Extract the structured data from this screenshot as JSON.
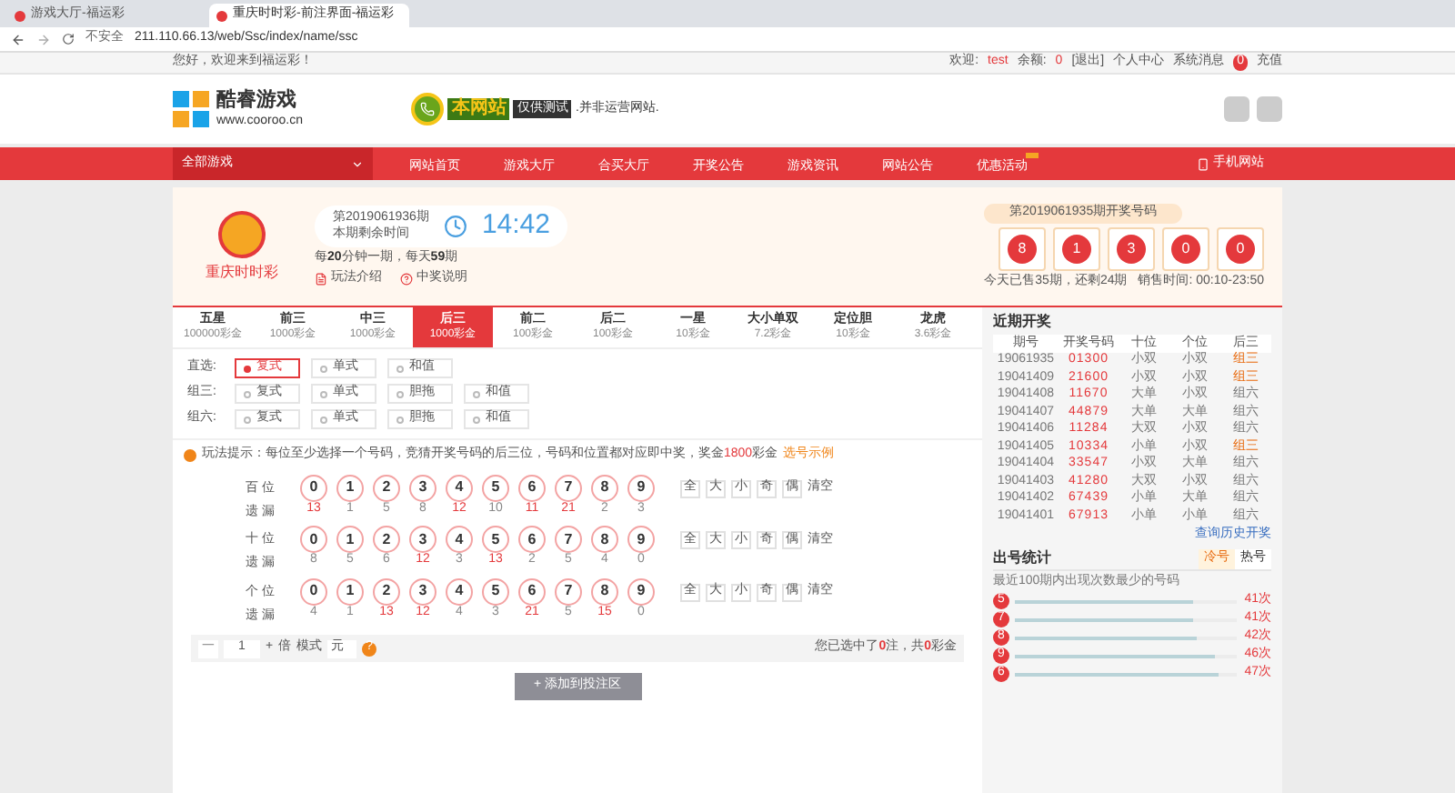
{
  "browser": {
    "tabs": [
      {
        "title": "游戏大厅-福运彩",
        "selected": false
      },
      {
        "title": "重庆时时彩-前注界面-福运彩",
        "selected": true
      }
    ],
    "security": "不安全",
    "url": "211.110.66.13/web/Ssc/index/name/ssc"
  },
  "topbar": {
    "greeting": "您好，欢迎来到福运彩！",
    "welcome_label": "欢迎:",
    "username": "test",
    "balance_label": "余额:",
    "balance": "0",
    "logout": "[退出]",
    "account": "个人中心",
    "messages": "系统消息",
    "message_count": "0",
    "recharge": "充值"
  },
  "header": {
    "logo_name": "酷睿游戏",
    "logo_url": "www.cooroo.cn",
    "banner_title": "本网站",
    "banner_badge": "仅供测试",
    "banner_note": ".并非运营网站."
  },
  "nav": {
    "category": "全部游戏",
    "items": [
      {
        "label": "网站首页",
        "hot": false
      },
      {
        "label": "游戏大厅",
        "hot": false
      },
      {
        "label": "合买大厅",
        "hot": false
      },
      {
        "label": "开奖公告",
        "hot": false
      },
      {
        "label": "游戏资讯",
        "hot": false
      },
      {
        "label": "网站公告",
        "hot": false
      },
      {
        "label": "优惠活动",
        "hot": true
      }
    ],
    "mobile": "手机网站"
  },
  "lottery": {
    "name": "重庆时时彩",
    "issue": "第2019061936期",
    "remaining_label": "本期剩余时间",
    "countdown": "14:42",
    "schedule": "每**20**分钟一期，每天**59**期",
    "rules_link": "玩法介绍",
    "prize_link": "中奖说明",
    "last_issue": "第2019061935期开奖号码",
    "last_numbers": [
      "8",
      "1",
      "3",
      "0",
      "0"
    ],
    "sales_info": "今天已售35期，还剩24期",
    "sales_time": "销售时间: 00:10-23:50"
  },
  "play_tabs": [
    {
      "label": "五星",
      "prize": "100000彩金",
      "selected": false
    },
    {
      "label": "前三",
      "prize": "1000彩金",
      "selected": false
    },
    {
      "label": "中三",
      "prize": "1000彩金",
      "selected": false
    },
    {
      "label": "后三",
      "prize": "1000彩金",
      "selected": true
    },
    {
      "label": "前二",
      "prize": "100彩金",
      "selected": false
    },
    {
      "label": "后二",
      "prize": "100彩金",
      "selected": false
    },
    {
      "label": "一星",
      "prize": "10彩金",
      "selected": false
    },
    {
      "label": "大小单双",
      "prize": "7.2彩金",
      "selected": false
    },
    {
      "label": "定位胆",
      "prize": "10彩金",
      "selected": false
    },
    {
      "label": "龙虎",
      "prize": "3.6彩金",
      "selected": false
    }
  ],
  "sub_modes": [
    {
      "label": "直选:",
      "options": [
        {
          "label": "复式",
          "selected": true
        },
        {
          "label": "单式",
          "selected": false
        },
        {
          "label": "和值",
          "selected": false
        }
      ]
    },
    {
      "label": "组三:",
      "options": [
        {
          "label": "复式",
          "selected": false
        },
        {
          "label": "单式",
          "selected": false
        },
        {
          "label": "胆拖",
          "selected": false
        },
        {
          "label": "和值",
          "selected": false
        }
      ]
    },
    {
      "label": "组六:",
      "options": [
        {
          "label": "复式",
          "selected": false
        },
        {
          "label": "单式",
          "selected": false
        },
        {
          "label": "胆拖",
          "selected": false
        },
        {
          "label": "和值",
          "selected": false
        }
      ]
    }
  ],
  "hint": {
    "text": "玩法提示：每位至少选择一个号码，竞猜开奖号码的后三位，号码和位置都对应即中奖，奖金**1800**彩金",
    "example_link": "选号示例"
  },
  "digit_rows": [
    {
      "position": "百 位",
      "miss_label": "遗 漏",
      "quick_buttons": [
        "全",
        "大",
        "小",
        "奇",
        "偶"
      ],
      "clear": "清空",
      "digits": [
        {
          "digit": "0",
          "miss": "13",
          "hot": true
        },
        {
          "digit": "1",
          "miss": "1",
          "hot": false
        },
        {
          "digit": "2",
          "miss": "5",
          "hot": false
        },
        {
          "digit": "3",
          "miss": "8",
          "hot": false
        },
        {
          "digit": "4",
          "miss": "12",
          "hot": true
        },
        {
          "digit": "5",
          "miss": "10",
          "hot": false
        },
        {
          "digit": "6",
          "miss": "11",
          "hot": true
        },
        {
          "digit": "7",
          "miss": "21",
          "hot": true
        },
        {
          "digit": "8",
          "miss": "2",
          "hot": false
        },
        {
          "digit": "9",
          "miss": "3",
          "hot": false
        }
      ]
    },
    {
      "position": "十 位",
      "miss_label": "遗 漏",
      "quick_buttons": [
        "全",
        "大",
        "小",
        "奇",
        "偶"
      ],
      "clear": "清空",
      "digits": [
        {
          "digit": "0",
          "miss": "8",
          "hot": false
        },
        {
          "digit": "1",
          "miss": "5",
          "hot": false
        },
        {
          "digit": "2",
          "miss": "6",
          "hot": false
        },
        {
          "digit": "3",
          "miss": "12",
          "hot": true
        },
        {
          "digit": "4",
          "miss": "3",
          "hot": false
        },
        {
          "digit": "5",
          "miss": "13",
          "hot": true
        },
        {
          "digit": "6",
          "miss": "2",
          "hot": false
        },
        {
          "digit": "7",
          "miss": "5",
          "hot": false
        },
        {
          "digit": "8",
          "miss": "4",
          "hot": false
        },
        {
          "digit": "9",
          "miss": "0",
          "hot": false
        }
      ]
    },
    {
      "position": "个 位",
      "miss_label": "遗 漏",
      "quick_buttons": [
        "全",
        "大",
        "小",
        "奇",
        "偶"
      ],
      "clear": "清空",
      "digits": [
        {
          "digit": "0",
          "miss": "4",
          "hot": false
        },
        {
          "digit": "1",
          "miss": "1",
          "hot": false
        },
        {
          "digit": "2",
          "miss": "13",
          "hot": true
        },
        {
          "digit": "3",
          "miss": "12",
          "hot": true
        },
        {
          "digit": "4",
          "miss": "4",
          "hot": false
        },
        {
          "digit": "5",
          "miss": "3",
          "hot": false
        },
        {
          "digit": "6",
          "miss": "21",
          "hot": true
        },
        {
          "digit": "7",
          "miss": "5",
          "hot": false
        },
        {
          "digit": "8",
          "miss": "15",
          "hot": true
        },
        {
          "digit": "9",
          "miss": "0",
          "hot": false
        }
      ]
    }
  ],
  "bet_bar": {
    "minus": "一",
    "multiple": "1",
    "plus": "+",
    "multiple_unit": "倍",
    "mode_label": "模式",
    "mode": "元",
    "help": "?",
    "summary": "您已选中了**0**注，共**0**彩金"
  },
  "add_button": "+ 添加到投注区",
  "recent": {
    "title": "近期开奖",
    "columns": [
      "期号",
      "开奖号码",
      "十位",
      "个位",
      "后三"
    ],
    "rows": [
      {
        "issue": "19061935",
        "numbers": "01300",
        "tens": "小双",
        "ones": "小双",
        "last3": "组三",
        "last3_hot": true
      },
      {
        "issue": "19041409",
        "numbers": "21600",
        "tens": "小双",
        "ones": "小双",
        "last3": "组三",
        "last3_hot": true
      },
      {
        "issue": "19041408",
        "numbers": "11670",
        "tens": "大单",
        "ones": "小双",
        "last3": "组六",
        "last3_hot": false
      },
      {
        "issue": "19041407",
        "numbers": "44879",
        "tens": "大单",
        "ones": "大单",
        "last3": "组六",
        "last3_hot": false
      },
      {
        "issue": "19041406",
        "numbers": "11284",
        "tens": "大双",
        "ones": "小双",
        "last3": "组六",
        "last3_hot": false
      },
      {
        "issue": "19041405",
        "numbers": "10334",
        "tens": "小单",
        "ones": "小双",
        "last3": "组三",
        "last3_hot": true
      },
      {
        "issue": "19041404",
        "numbers": "33547",
        "tens": "小双",
        "ones": "大单",
        "last3": "组六",
        "last3_hot": false
      },
      {
        "issue": "19041403",
        "numbers": "41280",
        "tens": "大双",
        "ones": "小双",
        "last3": "组六",
        "last3_hot": false
      },
      {
        "issue": "19041402",
        "numbers": "67439",
        "tens": "小单",
        "ones": "大单",
        "last3": "组六",
        "last3_hot": false
      },
      {
        "issue": "19041401",
        "numbers": "67913",
        "tens": "小单",
        "ones": "小单",
        "last3": "组六",
        "last3_hot": false
      }
    ],
    "history_link": "查询历史开奖"
  },
  "stats": {
    "title": "出号统计",
    "tabs": [
      {
        "label": "冷号",
        "selected": true
      },
      {
        "label": "热号",
        "selected": false
      }
    ],
    "caption": "最近100期内出现次数最少的号码",
    "items": [
      {
        "digit": "5",
        "count": "41次",
        "level": 0.8
      },
      {
        "digit": "7",
        "count": "41次",
        "level": 0.8
      },
      {
        "digit": "8",
        "count": "42次",
        "level": 0.82
      },
      {
        "digit": "9",
        "count": "46次",
        "level": 0.9
      },
      {
        "digit": "6",
        "count": "47次",
        "level": 0.92
      }
    ]
  }
}
